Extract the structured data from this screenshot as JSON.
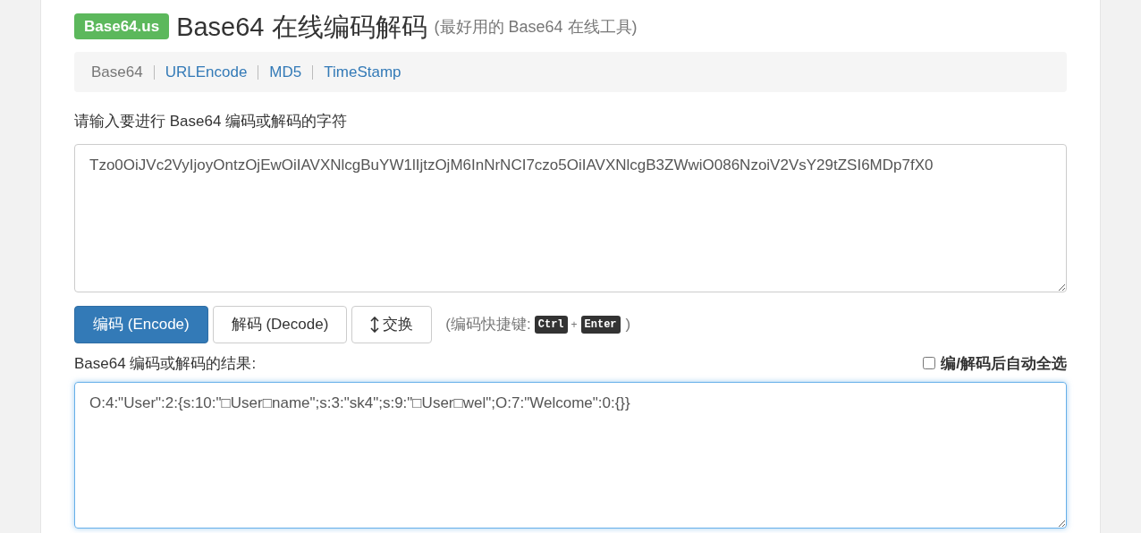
{
  "header": {
    "badge": "Base64.us",
    "title": "Base64 在线编码解码",
    "subtitle": "(最好用的 Base64 在线工具)"
  },
  "nav": [
    {
      "label": "Base64",
      "selected": true
    },
    {
      "label": "URLEncode",
      "selected": false
    },
    {
      "label": "MD5",
      "selected": false
    },
    {
      "label": "TimeStamp",
      "selected": false
    }
  ],
  "input": {
    "label": "请输入要进行 Base64 编码或解码的字符",
    "value": "Tzo0OiJVc2VyIjoyOntzOjEwOiIAVXNlcgBuYW1lIjtzOjM6InNrNCI7czo5OiIAVXNlcgB3ZWwiO086NzoiV2VsY29tZSI6MDp7fX0"
  },
  "buttons": [
    {
      "label": "编码 (Encode)",
      "kind": "primary"
    },
    {
      "label": "解码 (Decode)",
      "kind": "default"
    },
    {
      "label": "交换",
      "kind": "swap"
    }
  ],
  "shortcut": {
    "prefix": "(编码快捷键:",
    "keys": [
      "Ctrl",
      "Enter"
    ],
    "joiner": "+",
    "suffix": ")"
  },
  "output": {
    "label": "Base64 编码或解码的结果:",
    "auto_select": {
      "label": "编/解码后自动全选",
      "checked": false
    },
    "value": "O:4:\"User\":2:{s:10:\"□User□name\";s:3:\"sk4\";s:9:\"□User□wel\";O:7:\"Welcome\":0:{}}",
    "focused": true
  }
}
